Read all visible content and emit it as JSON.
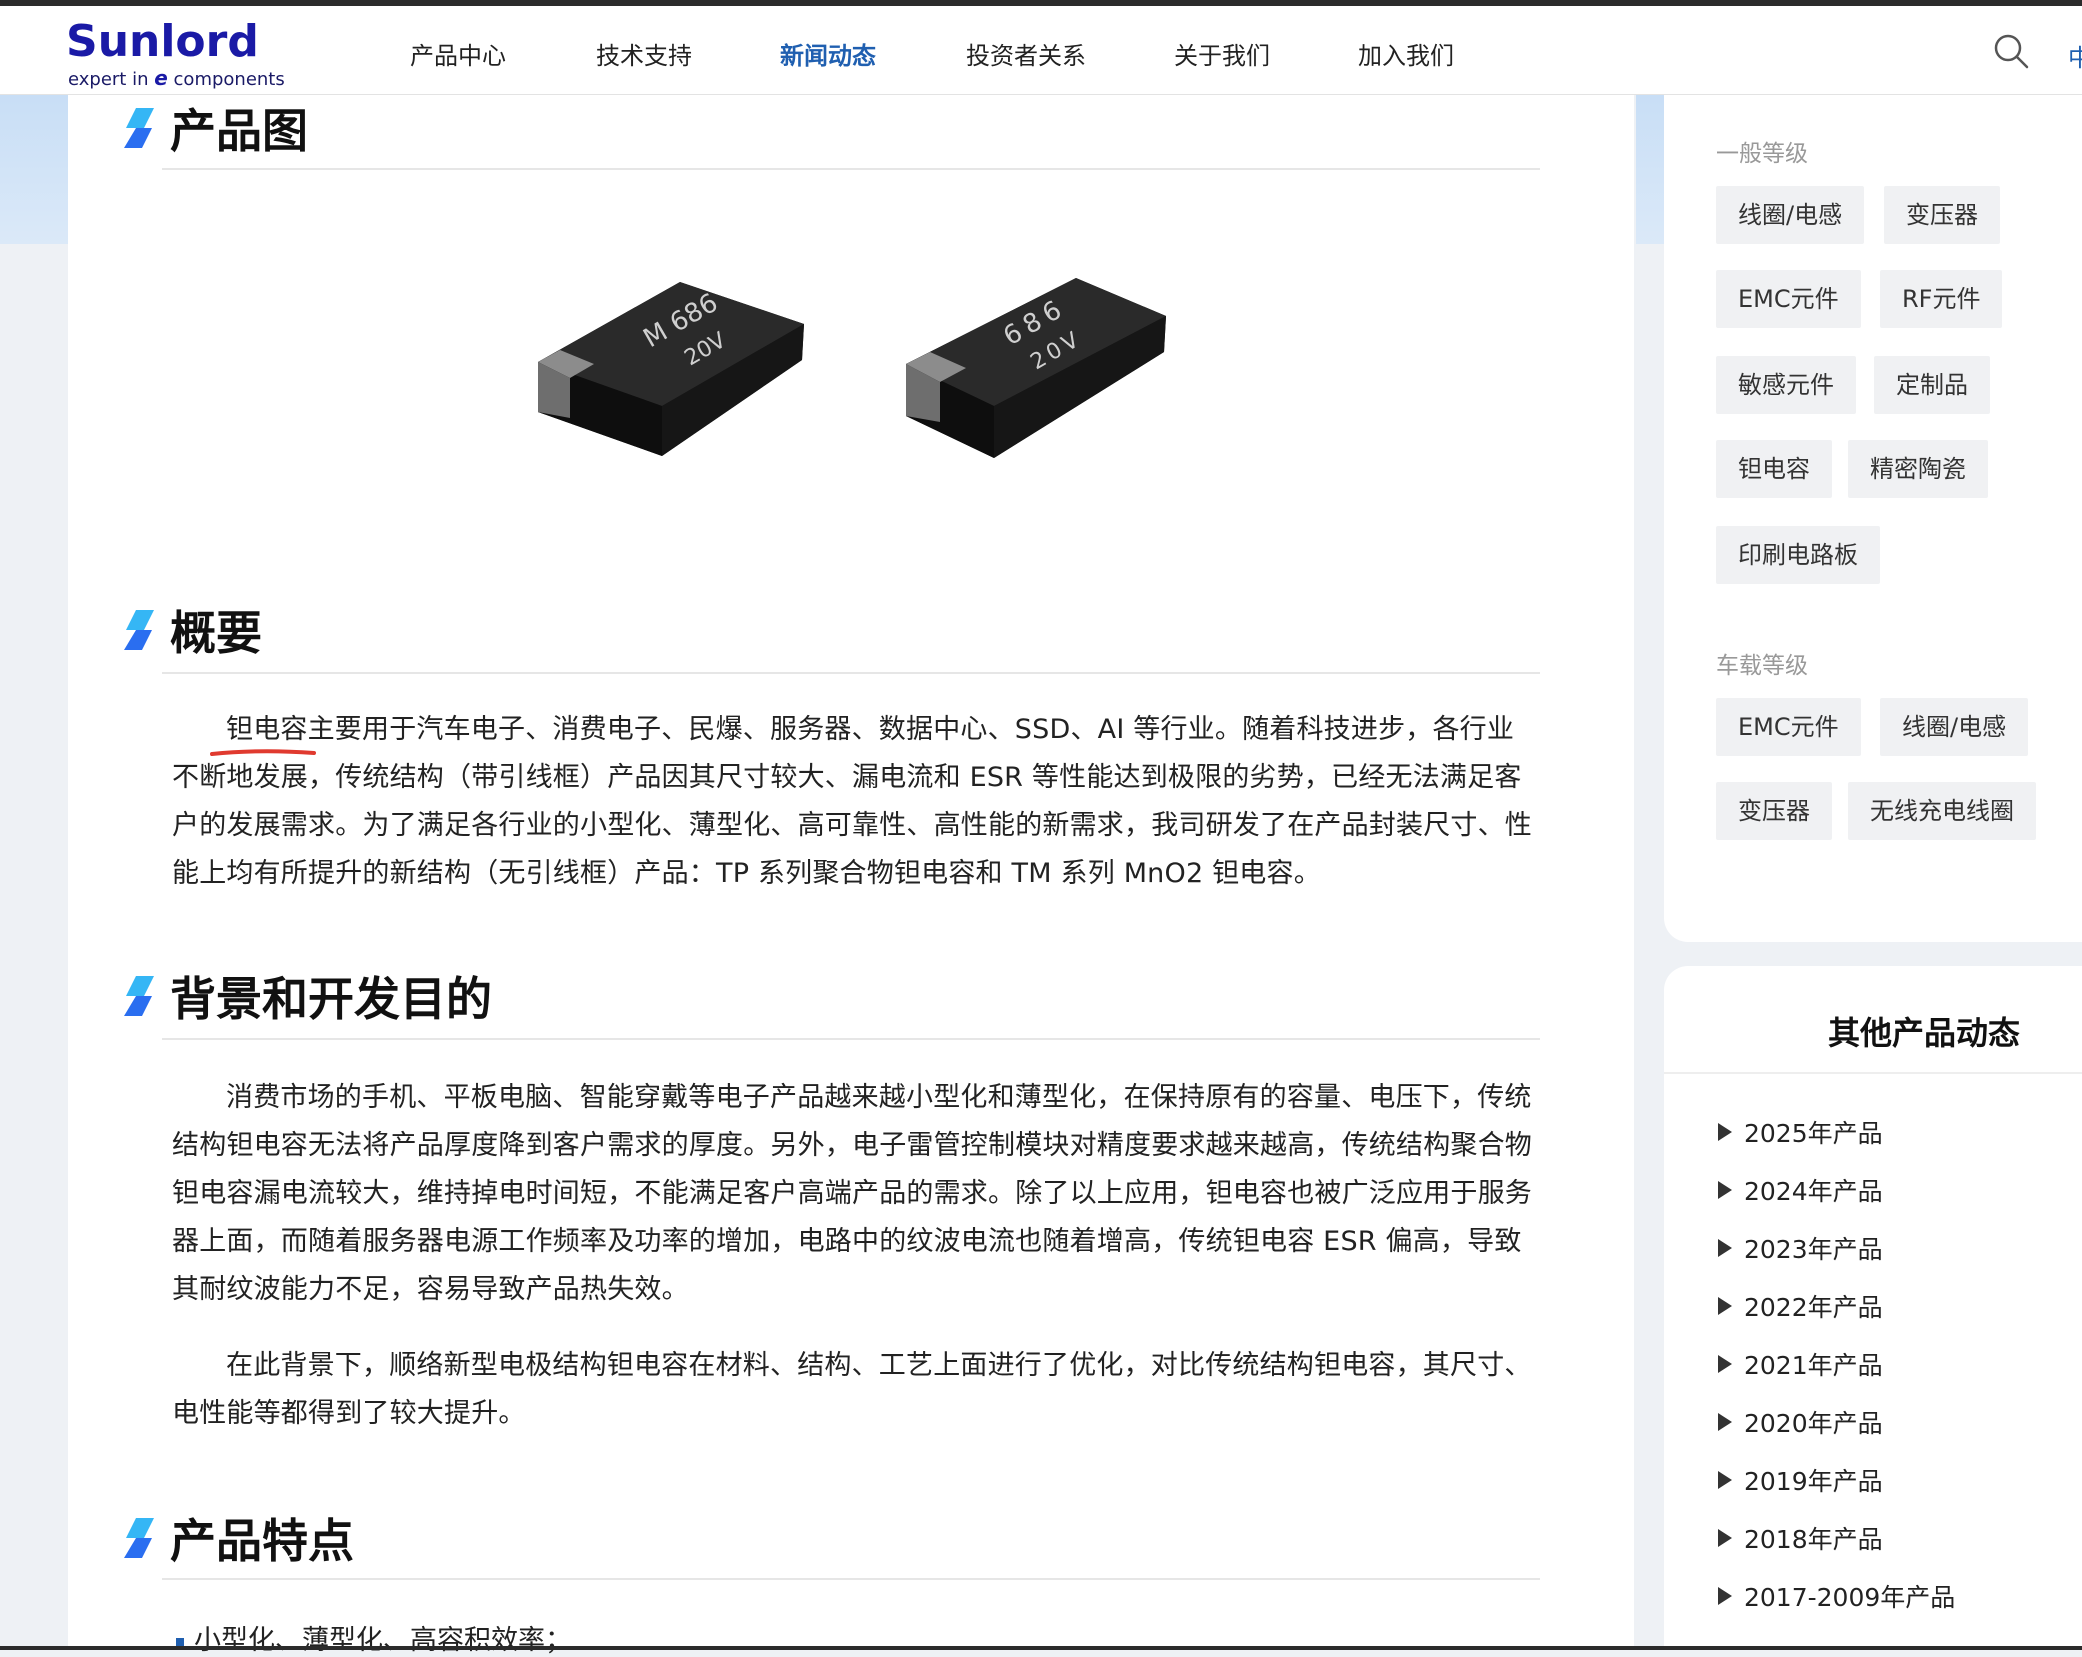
{
  "header": {
    "logo_main": "Sunlord",
    "logo_sub_pre": "expert in ",
    "logo_sub_e": "e",
    "logo_sub_post": " components",
    "nav": [
      "产品中心",
      "技术支持",
      "新闻动态",
      "投资者关系",
      "关于我们",
      "加入我们"
    ],
    "active_nav": "新闻动态",
    "lang_label": "中"
  },
  "sections": {
    "product_image_title": "产品图",
    "overview_title": "概要",
    "overview_text": "钽电容主要用于汽车电子、消费电子、民爆、服务器、数据中心、SSD、AI 等行业。随着科技进步，各行业不断地发展，传统结构（带引线框）产品因其尺寸较大、漏电流和 ESR 等性能达到极限的劣势，已经无法满足客户的发展需求。为了满足各行业的小型化、薄型化、高可靠性、高性能的新需求，我司研发了在产品封装尺寸、性能上均有所提升的新结构（无引线框）产品：TP 系列聚合物钽电容和 TM 系列 MnO2 钽电容。",
    "background_title": "背景和开发目的",
    "background_p1": "消费市场的手机、平板电脑、智能穿戴等电子产品越来越小型化和薄型化，在保持原有的容量、电压下，传统结构钽电容无法将产品厚度降到客户需求的厚度。另外，电子雷管控制模块对精度要求越来越高，传统结构聚合物钽电容漏电流较大，维持掉电时间短，不能满足客户高端产品的需求。除了以上应用，钽电容也被广泛应用于服务器上面，而随着服务器电源工作频率及功率的增加，电路中的纹波电流也随着增高，传统钽电容 ESR 偏高，导致其耐纹波能力不足，容易导致产品热失效。",
    "background_p2": "在此背景下，顺络新型电极结构钽电容在材料、结构、工艺上面进行了优化，对比传统结构钽电容，其尺寸、电性能等都得到了较大提升。",
    "features_title": "产品特点",
    "feature_1": "小型化、薄型化、高容积效率；"
  },
  "product_images": {
    "chip1_line1": "M 686",
    "chip1_line2": "20V",
    "chip2_line1": "686",
    "chip2_line2": "20V"
  },
  "sidebar": {
    "general_label": "一般等级",
    "general_tags": [
      "线圈/电感",
      "变压器",
      "EMC元件",
      "RF元件",
      "敏感元件",
      "定制品",
      "钽电容",
      "精密陶瓷",
      "印刷电路板"
    ],
    "auto_label": "车载等级",
    "auto_tags": [
      "EMC元件",
      "线圈/电感",
      "变压器",
      "无线充电线圈"
    ],
    "other_title": "其他产品动态",
    "years": [
      "2025年产品",
      "2024年产品",
      "2023年产品",
      "2022年产品",
      "2021年产品",
      "2020年产品",
      "2019年产品",
      "2018年产品",
      "2017-2009年产品"
    ]
  },
  "icons": {
    "section_marker": "blue-slash-icon",
    "search": "search-icon",
    "year_bullet": "triangle-right-icon"
  },
  "colors": {
    "brand_blue": "#1a1aa6",
    "nav_active": "#1f5fb0",
    "marker_blue": "#2a6ef0",
    "marker_cyan": "#35b6f5",
    "underline_red": "#e03a2f"
  }
}
